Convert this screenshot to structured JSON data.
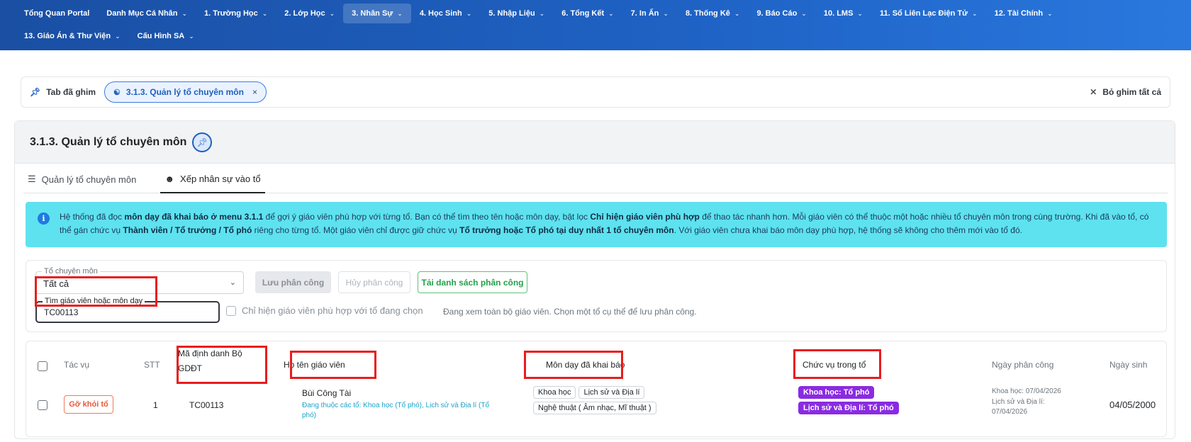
{
  "nav": {
    "row1": [
      {
        "label": "Tổng Quan Portal",
        "chevron": false
      },
      {
        "label": "Danh Mục Cá Nhân",
        "chevron": true
      },
      {
        "label": "1. Trường Học",
        "chevron": true
      },
      {
        "label": "2. Lớp Học",
        "chevron": true
      },
      {
        "label": "3. Nhân Sự",
        "chevron": true,
        "active": true
      },
      {
        "label": "4. Học Sinh",
        "chevron": true
      },
      {
        "label": "5. Nhập Liệu",
        "chevron": true
      },
      {
        "label": "6. Tổng Kết",
        "chevron": true
      },
      {
        "label": "7. In Ấn",
        "chevron": true
      },
      {
        "label": "8. Thống Kê",
        "chevron": true
      },
      {
        "label": "9. Báo Cáo",
        "chevron": true
      },
      {
        "label": "10. LMS",
        "chevron": true
      },
      {
        "label": "11. Sổ Liên Lạc Điện Tử",
        "chevron": true
      },
      {
        "label": "12. Tài Chính",
        "chevron": true
      }
    ],
    "row2": [
      {
        "label": "13. Giáo Án & Thư Viện",
        "chevron": true
      },
      {
        "label": "Cấu Hình SA",
        "chevron": true
      }
    ]
  },
  "pinbar": {
    "label": "Tab đã ghim",
    "pinned_tab": "3.1.3. Quản lý tổ chuyên môn",
    "close_glyph": "×",
    "unpin_all": "Bỏ ghim tất cả"
  },
  "page": {
    "title": "3.1.3. Quản lý tổ chuyên môn",
    "tabs": [
      {
        "label": "Quản lý tổ chuyên môn",
        "icon": "list-icon"
      },
      {
        "label": "Xếp nhân sự vào tổ",
        "icon": "users-icon",
        "active": true
      }
    ]
  },
  "info": {
    "p1": "Hệ thống đã đọc ",
    "b1": "môn dạy đã khai báo ở menu 3.1.1",
    "p2": " để gợi ý giáo viên phù hợp với từng tổ. Bạn có thể tìm theo tên hoặc môn dạy, bật lọc ",
    "b2": "Chỉ hiện giáo viên phù hợp",
    "p3": " để thao tác nhanh hơn. Mỗi giáo viên có thể thuộc một hoặc nhiều tổ chuyên môn trong cùng trường. Khi đã vào tổ, có thể gán chức vụ ",
    "b3": "Thành viên / Tổ trưởng / Tổ phó",
    "p4": " riêng cho từng tổ. Một giáo viên chỉ được giữ chức vụ ",
    "b4": "Tổ trưởng hoặc Tổ phó tại duy nhất 1 tổ chuyên môn",
    "p5": ". Với giáo viên chưa khai báo môn dạy phù hợp, hệ thống sẽ không cho thêm mới vào tổ đó."
  },
  "filter": {
    "group_label": "Tổ chuyên môn",
    "group_value": "Tất cả",
    "save_label": "Lưu phân công",
    "cancel_label": "Hủy phân công",
    "load_label": "Tải danh sách phân công",
    "search_label": "Tìm giáo viên hoặc môn dạy",
    "search_value": "TC00113",
    "only_matching_label": "Chỉ hiện giáo viên phù hợp với tổ đang chọn",
    "hint": "Đang xem toàn bộ giáo viên. Chọn một tổ cụ thể để lưu phân công."
  },
  "table": {
    "headers": {
      "action": "Tác vụ",
      "stt": "STT",
      "code_l1": "Mã định danh Bộ",
      "code_l2": "GDĐT",
      "name": "Họ tên giáo viên",
      "subjects": "Môn dạy đã khai báo",
      "role": "Chức vụ trong tổ",
      "assigned": "Ngày phân công",
      "dob": "Ngày sinh"
    },
    "row": {
      "remove_label": "Gỡ khỏi tổ",
      "stt": "1",
      "code": "TC00113",
      "name": "Bùi Công Tài",
      "groups_note": "Đang thuộc các tổ: Khoa học (Tổ phó), Lịch sử và Địa lí (Tổ phó)",
      "subjects": [
        "Khoa học",
        "Lịch sử và Địa lí",
        "Nghệ thuật ( Âm nhạc, Mĩ thuật )"
      ],
      "roles": [
        "Khoa học: Tổ phó",
        "Lịch sử và Địa lí: Tổ phó"
      ],
      "assigned_1": "Khoa học: 07/04/2026",
      "assigned_2": "Lịch sử và Địa lí:",
      "assigned_3": "07/04/2026",
      "dob": "04/05/2000"
    }
  },
  "colors": {
    "nav_bg": "#1f63c6",
    "highlight": "#e81d1d",
    "role_badge": "#8a2be2",
    "info_bg": "#5ee2ef"
  }
}
